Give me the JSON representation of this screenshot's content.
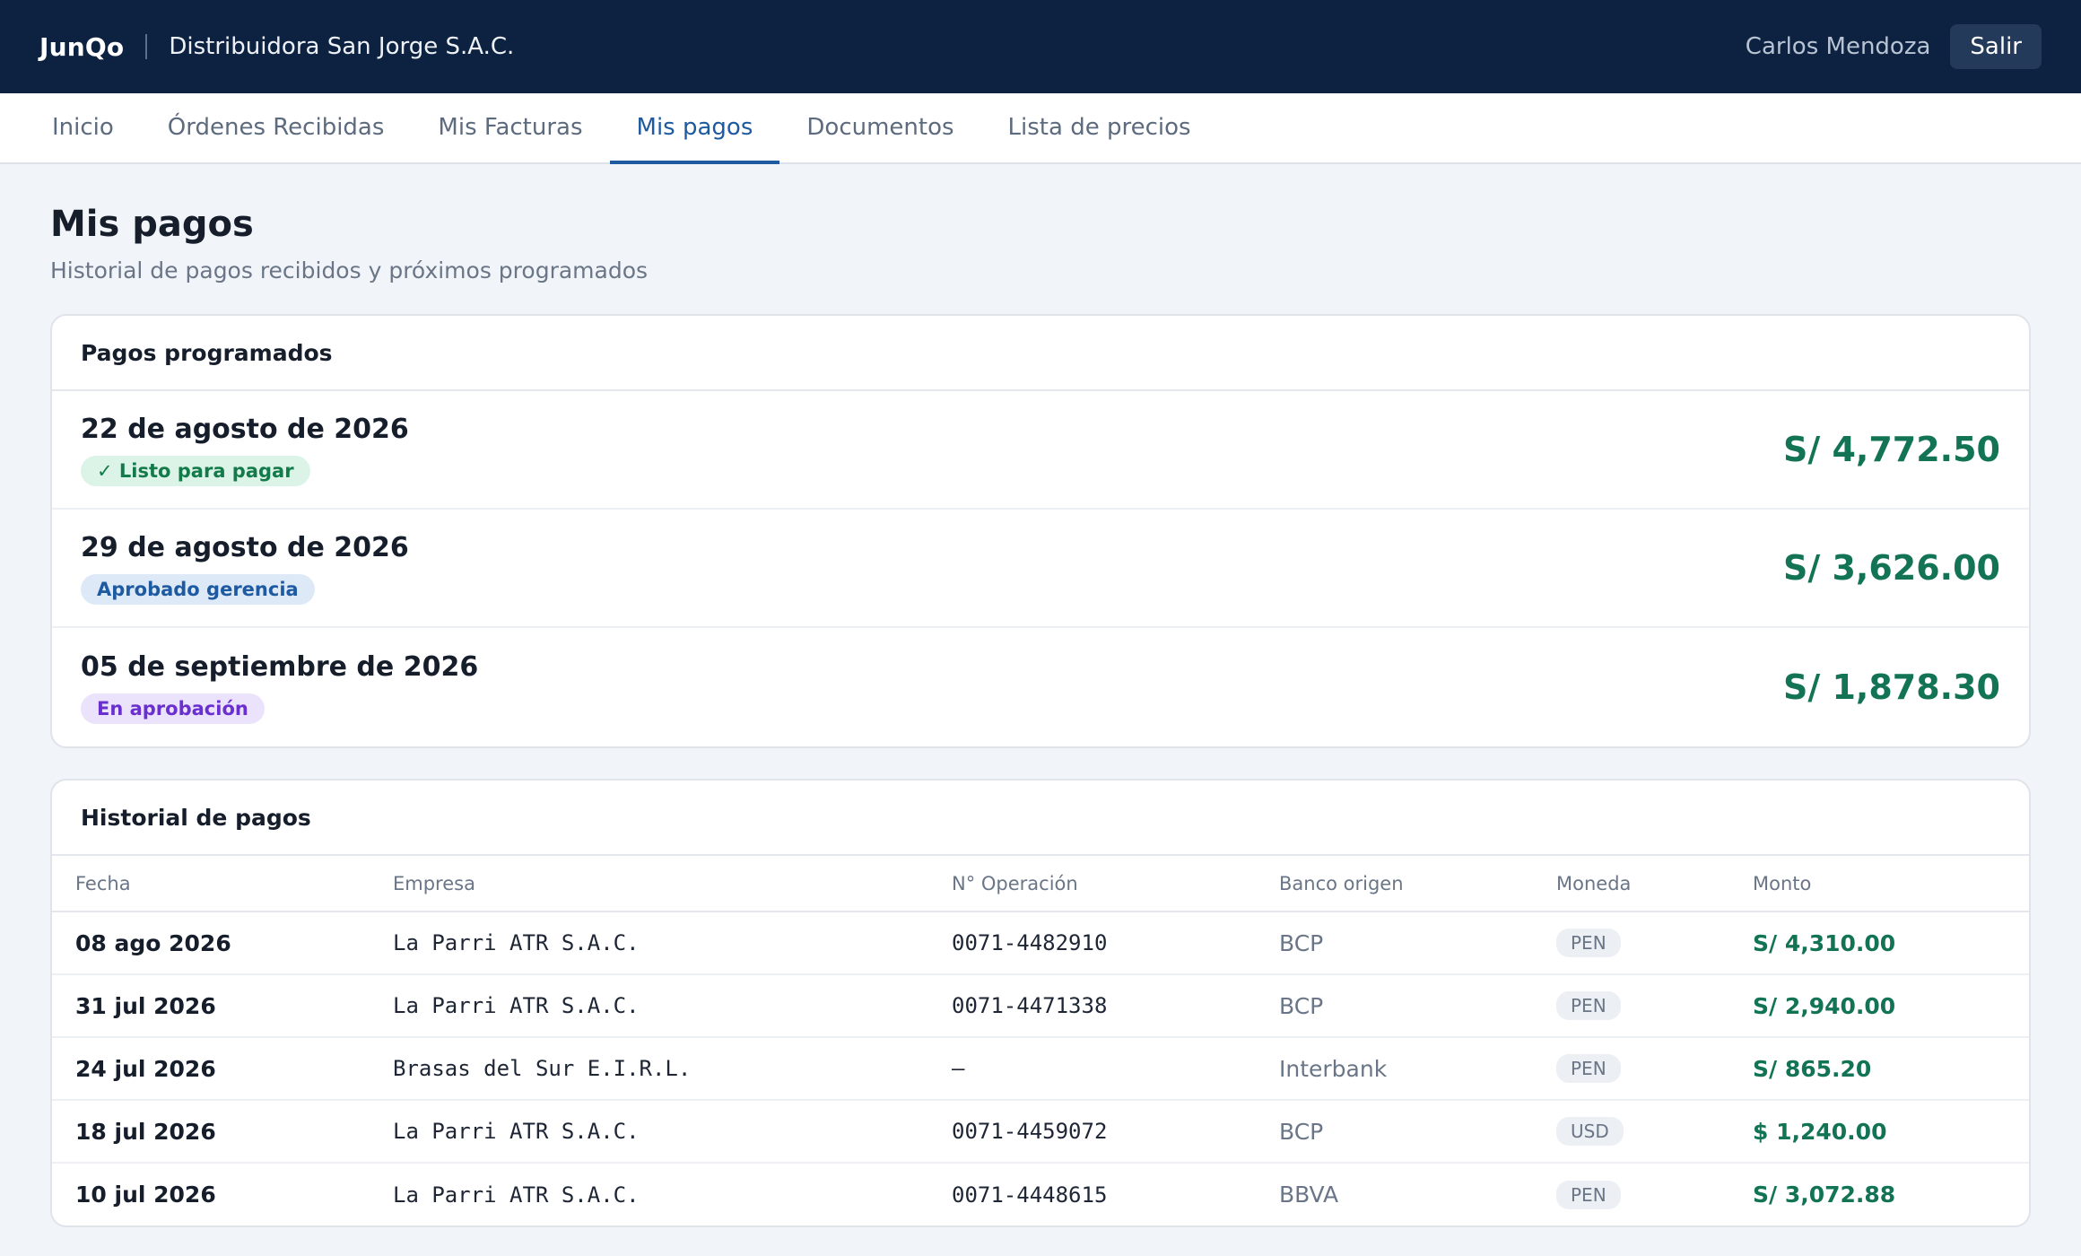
{
  "header": {
    "brand": "JunQo",
    "company": "Distribuidora San Jorge S.A.C.",
    "user": "Carlos Mendoza",
    "logout_label": "Salir"
  },
  "tabs": [
    {
      "label": "Inicio"
    },
    {
      "label": "Órdenes Recibidas"
    },
    {
      "label": "Mis Facturas"
    },
    {
      "label": "Mis pagos"
    },
    {
      "label": "Documentos"
    },
    {
      "label": "Lista de precios"
    }
  ],
  "active_tab": "Mis pagos",
  "page": {
    "title": "Mis pagos",
    "subtitle": "Historial de pagos recibidos y próximos programados"
  },
  "scheduled": {
    "title": "Pagos programados",
    "items": [
      {
        "date": "22 de agosto de 2026",
        "status": "✓ Listo para pagar",
        "amount": "S/ 4,772.50"
      },
      {
        "date": "29 de agosto de 2026",
        "status": "Aprobado gerencia",
        "amount": "S/ 3,626.00"
      },
      {
        "date": "05 de septiembre de 2026",
        "status": "En aprobación",
        "amount": "S/ 1,878.30"
      }
    ]
  },
  "history": {
    "title": "Historial de pagos",
    "columns": [
      "Fecha",
      "Empresa",
      "N° Operación",
      "Banco origen",
      "Moneda",
      "Monto"
    ],
    "rows": [
      {
        "fecha": "08 ago 2026",
        "empresa": "La Parri ATR S.A.C.",
        "operacion": "0071-4482910",
        "banco": "BCP",
        "moneda": "PEN",
        "monto": "S/ 4,310.00"
      },
      {
        "fecha": "31 jul 2026",
        "empresa": "La Parri ATR S.A.C.",
        "operacion": "0071-4471338",
        "banco": "BCP",
        "moneda": "PEN",
        "monto": "S/ 2,940.00"
      },
      {
        "fecha": "24 jul 2026",
        "empresa": "Brasas del Sur E.I.R.L.",
        "operacion": "—",
        "banco": "Interbank",
        "moneda": "PEN",
        "monto": "S/ 865.20"
      },
      {
        "fecha": "18 jul 2026",
        "empresa": "La Parri ATR S.A.C.",
        "operacion": "0071-4459072",
        "banco": "BCP",
        "moneda": "USD",
        "monto": "$ 1,240.00"
      },
      {
        "fecha": "10 jul 2026",
        "empresa": "La Parri ATR S.A.C.",
        "operacion": "0071-4448615",
        "banco": "BBVA",
        "moneda": "PEN",
        "monto": "S/ 3,072.88"
      }
    ]
  },
  "colors": {
    "topbar": "#0d2240",
    "accent": "#1e5aa0",
    "amount_green": "#137355"
  }
}
